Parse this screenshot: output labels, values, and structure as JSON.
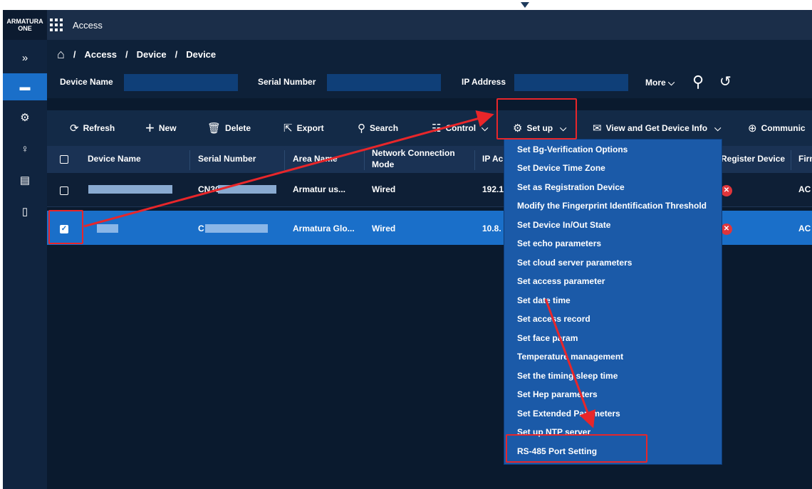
{
  "brand": {
    "line1": "ARMATURA",
    "line2": "ONE"
  },
  "app_title": "Access",
  "sidebar": {
    "items": [
      {
        "icon": "double-chevron-right-icon",
        "glyph": "»"
      },
      {
        "icon": "card-reader-icon",
        "glyph": "▬"
      },
      {
        "icon": "gear-icon",
        "glyph": "⚙"
      },
      {
        "icon": "person-key-icon",
        "glyph": "♀"
      },
      {
        "icon": "document-icon",
        "glyph": "▤"
      },
      {
        "icon": "device-icon",
        "glyph": "▯"
      }
    ]
  },
  "breadcrumb": {
    "home_icon": "⌂",
    "sep": "/",
    "items": [
      "Access",
      "Device",
      "Device"
    ]
  },
  "filters": {
    "device_name": "Device Name",
    "serial_number": "Serial Number",
    "ip_address": "IP Address",
    "more": "More",
    "more_chevron": "⌵",
    "search_glyph": "⚲",
    "reset_glyph": "↺"
  },
  "toolbar": {
    "refresh": "Refresh",
    "refresh_glyph": "⟳",
    "new": "New",
    "new_glyph": "+",
    "delete": "Delete",
    "delete_glyph": "🗑",
    "export": "Export",
    "export_glyph": "⇱",
    "search": "Search",
    "search_glyph": "⚲",
    "control": "Control",
    "control_glyph": "☷",
    "setup": "Set up",
    "setup_glyph": "⚙",
    "view_info": "View and Get Device Info",
    "view_glyph": "✉",
    "communic": "Communic",
    "communic_glyph": "⊕",
    "chevron": "⌵"
  },
  "table": {
    "headers": {
      "device_name": "Device Name",
      "serial_number": "Serial Number",
      "area_name": "Area Name",
      "network_line1": "Network Connection",
      "network_line2": "Mode",
      "ip": "IP Ac",
      "register": "Register Device",
      "firmware": "Firm"
    },
    "rows": [
      {
        "serial": "CN30",
        "area": "Armatur   us...",
        "network": "Wired",
        "ip": "192.1",
        "fw": "AC",
        "checked": false
      },
      {
        "serial": "C",
        "area": "Armatura Glo...",
        "network": "Wired",
        "ip": "10.8.",
        "fw": "AC",
        "checked": true
      }
    ],
    "check_glyph": "✓",
    "status_glyph": "✕"
  },
  "setup_menu": [
    "Set Bg-Verification Options",
    "Set Device Time Zone",
    "Set as Registration Device",
    "Modify the Fingerprint Identification Threshold",
    "Set Device In/Out State",
    "Set echo parameters",
    "Set cloud server parameters",
    "Set access parameter",
    "Set date time",
    "Set access record",
    "Set face param",
    "Temperature management",
    "Set the timing sleep time",
    "Set Hep parameters",
    "Set Extended Parameters",
    "Set up NTP server",
    "RS-485 Port Setting"
  ],
  "colors": {
    "accent": "#1a6fc9",
    "annotation": "#e8262a"
  }
}
